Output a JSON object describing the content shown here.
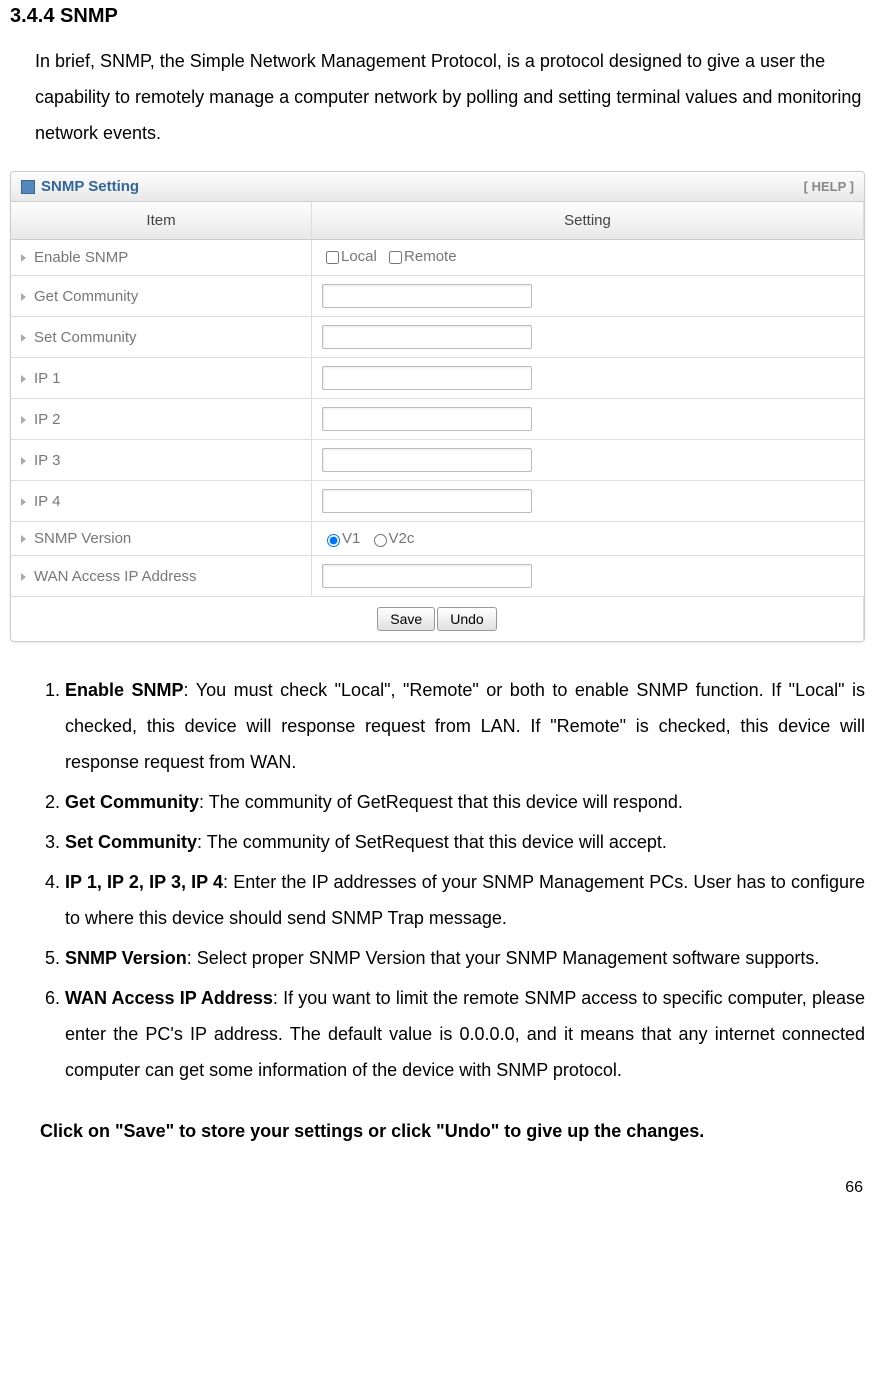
{
  "heading": "3.4.4 SNMP",
  "intro": "In brief, SNMP, the Simple Network Management Protocol, is a protocol designed to give a user the capability to remotely manage a computer network by polling and setting terminal values and monitoring network events.",
  "panel": {
    "title": "SNMP Setting",
    "help": "[ HELP ]",
    "col_item": "Item",
    "col_setting": "Setting",
    "rows": [
      {
        "label": "Enable SNMP"
      },
      {
        "label": "Get Community"
      },
      {
        "label": "Set Community"
      },
      {
        "label": "IP 1"
      },
      {
        "label": "IP 2"
      },
      {
        "label": "IP 3"
      },
      {
        "label": "IP 4"
      },
      {
        "label": "SNMP Version"
      },
      {
        "label": "WAN Access IP Address"
      }
    ],
    "check_local": "Local",
    "check_remote": "Remote",
    "radio_v1": "V1",
    "radio_v2c": "V2c",
    "save": "Save",
    "undo": "Undo"
  },
  "items": {
    "i1": {
      "b": "Enable SNMP",
      "t": ": You must check \"Local\", \"Remote\" or both to enable SNMP function. If \"Local\" is checked, this device will response request from LAN. If \"Remote\" is checked, this device will response request from WAN."
    },
    "i2": {
      "b": "Get Community",
      "t": ": The community of GetRequest that this device will respond."
    },
    "i3": {
      "b": "Set Community",
      "t": ": The community of SetRequest that this device will accept."
    },
    "i4": {
      "b": "IP 1, IP 2, IP 3, IP 4",
      "t": ": Enter the IP addresses of your SNMP Management PCs. User has to configure to where this device should send SNMP Trap message."
    },
    "i5": {
      "b": "SNMP Version",
      "t": ": Select proper SNMP Version that your SNMP Management software supports."
    },
    "i6": {
      "b": "WAN Access IP Address",
      "t": ": If you want to limit the remote SNMP access to specific computer, please enter the PC's IP address. The default value is 0.0.0.0, and it means that any internet connected computer can get some information of the device with SNMP protocol."
    }
  },
  "closing": "Click on \"Save\" to store your settings or click \"Undo\" to give up the changes.",
  "page_number": "66"
}
